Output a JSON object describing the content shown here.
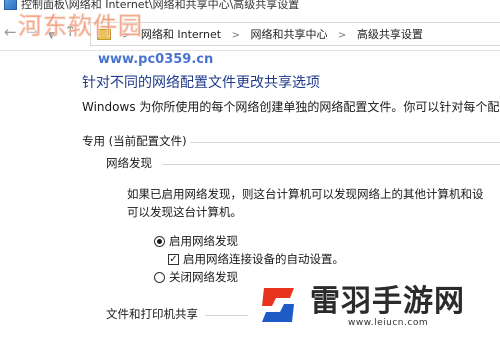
{
  "window": {
    "title": "控制面板\\网络和 Internet\\网络和共享中心\\高级共享设置"
  },
  "address_bar": {
    "breadcrumbs": [
      "网络和 Internet",
      "网络和共享中心",
      "高级共享设置"
    ],
    "nav_icons": [
      "back-arrow-icon",
      "forward-arrow-icon",
      "recent-locations-icon",
      "up-arrow-icon",
      "folder-icon"
    ]
  },
  "main": {
    "title": "针对不同的网络配置文件更改共享选项",
    "description": "Windows 为你所使用的每个网络创建单独的网络配置文件。你可以针对每个配置",
    "profile_header": "专用 (当前配置文件)",
    "network_discovery": {
      "header": "网络发现",
      "description_line1": "如果已启用网络发现，则这台计算机可以发现网络上的其他计算机和设",
      "description_line2": "可以发现这台计算机。",
      "option_on": "启用网络发现",
      "option_on_checked": true,
      "auto_setup": "启用网络连接设备的自动设置。",
      "auto_setup_checked": true,
      "option_off": "关闭网络发现",
      "option_off_checked": false
    },
    "file_printer_sharing": {
      "header": "文件和打印机共享"
    }
  },
  "watermarks": {
    "top_title": "河东软件园",
    "top_url": "www.pc0359.cn",
    "bottom_title": "雷羽手游网",
    "bottom_url": "www.leiucn.com",
    "colors": {
      "top_title": "#e65014",
      "top_url": "#285ac8",
      "bottom_logo_red": "#e8331f",
      "bottom_logo_blue": "#1e5bc6"
    }
  },
  "colors": {
    "title_blue": "#1e3a8a",
    "text": "#1a1a1a",
    "divider": "#d6d6d6"
  }
}
